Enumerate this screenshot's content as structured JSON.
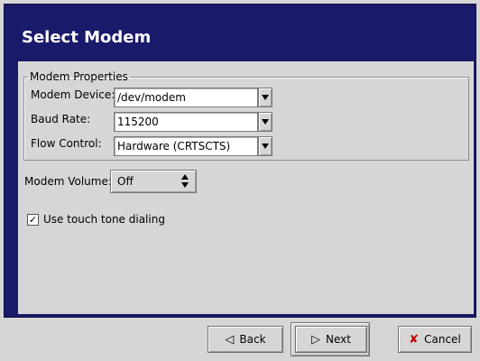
{
  "header": {
    "title": "Select Modem"
  },
  "properties": {
    "legend": "Modem Properties",
    "device": {
      "label": "Modem Device:",
      "value": "/dev/modem"
    },
    "baud": {
      "label": "Baud Rate:",
      "value": "115200"
    },
    "flow": {
      "label": "Flow Control:",
      "value": "Hardware (CRTSCTS)"
    }
  },
  "volume": {
    "label": "Modem Volume:",
    "value": "Off"
  },
  "touch_tone": {
    "label": "Use touch tone dialing",
    "checked": true
  },
  "buttons": {
    "back": "Back",
    "next": "Next",
    "cancel": "Cancel"
  },
  "colors": {
    "header_bg": "#1a1a6b",
    "window_bg": "#d6d6d6",
    "cancel_icon": "#c00000"
  },
  "icons": {
    "back": "arrow-left-icon",
    "next": "arrow-right-icon",
    "cancel": "x-icon",
    "check": "checkmark-icon"
  }
}
